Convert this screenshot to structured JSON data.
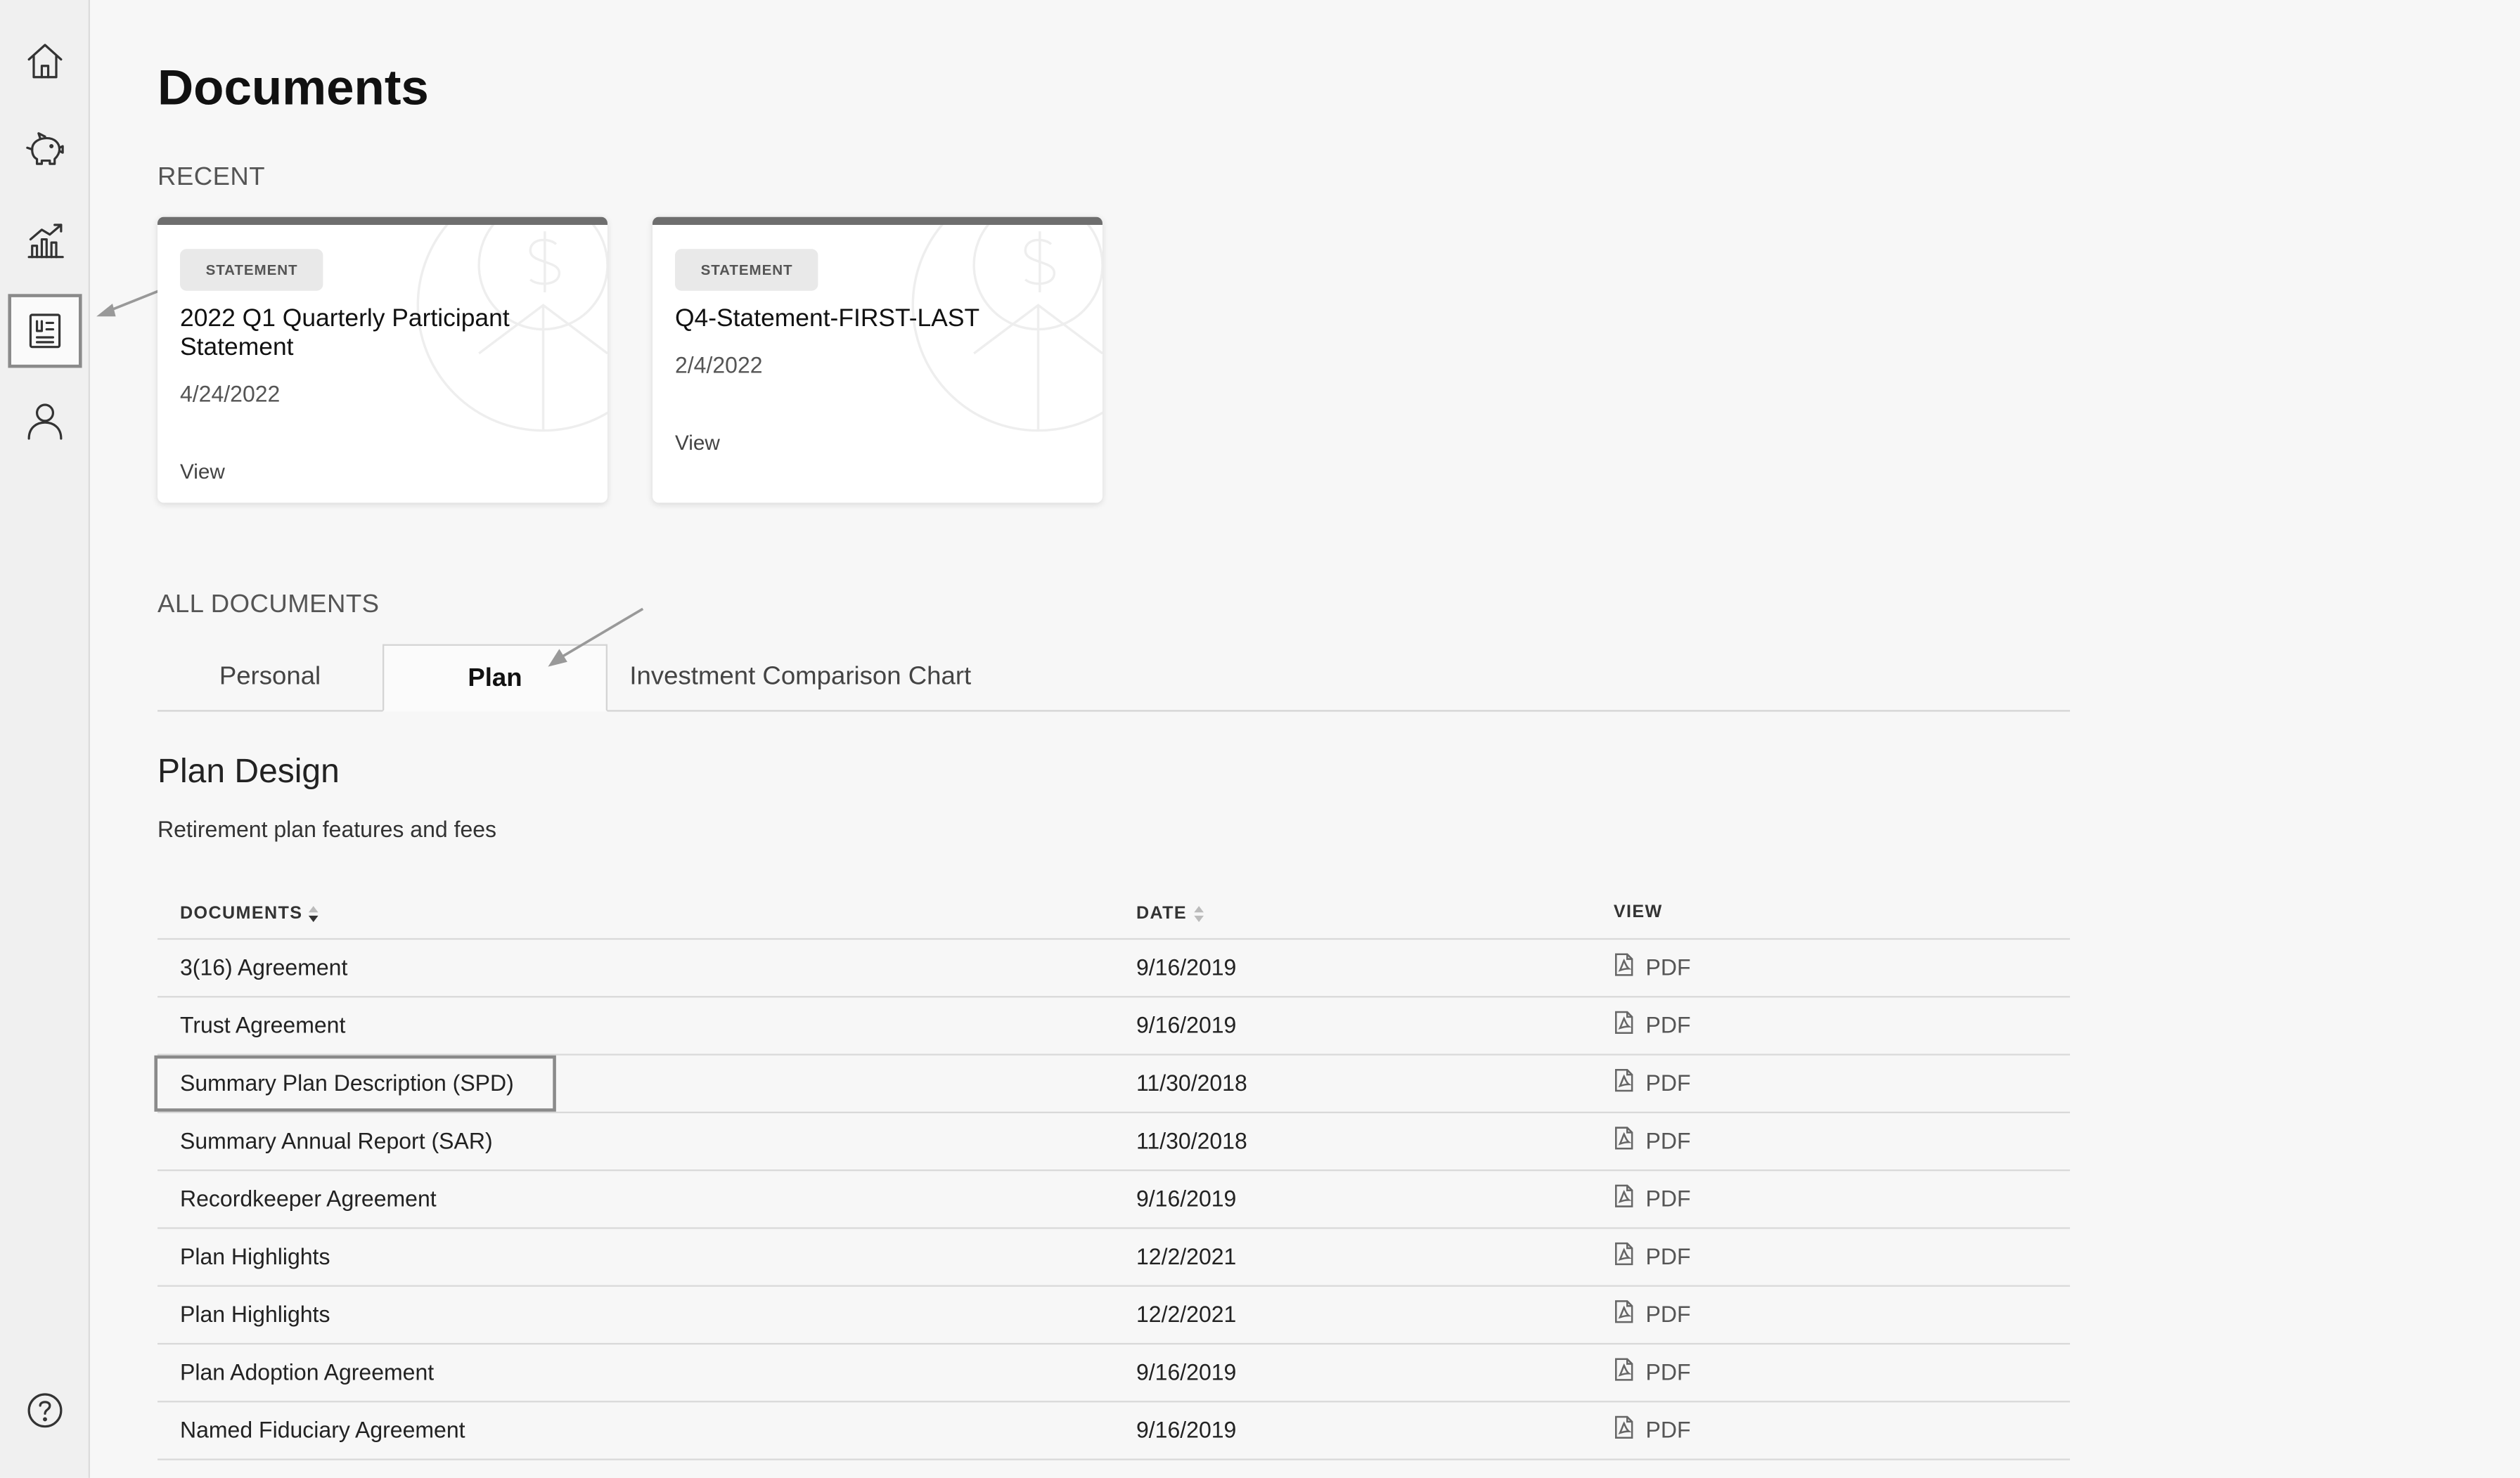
{
  "sidebar": {
    "items": [
      {
        "name": "home-icon"
      },
      {
        "name": "piggy-bank-icon"
      },
      {
        "name": "chart-icon"
      },
      {
        "name": "documents-icon",
        "active": true
      },
      {
        "name": "profile-icon"
      },
      {
        "name": "help-icon"
      }
    ]
  },
  "page": {
    "title": "Documents"
  },
  "recent": {
    "label": "RECENT",
    "cards": [
      {
        "badge": "STATEMENT",
        "title": "2022 Q1 Quarterly Participant Statement",
        "date": "4/24/2022",
        "action": "View"
      },
      {
        "badge": "STATEMENT",
        "title": "Q4-Statement-FIRST-LAST",
        "date": "2/4/2022",
        "action": "View"
      }
    ]
  },
  "all_documents": {
    "label": "ALL DOCUMENTS",
    "tabs": [
      {
        "label": "Personal",
        "active": false
      },
      {
        "label": "Plan",
        "active": true
      },
      {
        "label": "Investment Comparison Chart",
        "active": false
      }
    ]
  },
  "group": {
    "title": "Plan Design",
    "subtitle": "Retirement plan features and fees"
  },
  "table": {
    "headers": [
      "DOCUMENTS",
      "DATE",
      "VIEW"
    ],
    "rows": [
      {
        "name": "3(16) Agreement",
        "date": "9/16/2019",
        "view": "PDF"
      },
      {
        "name": "Trust Agreement",
        "date": "9/16/2019",
        "view": "PDF"
      },
      {
        "name": "Summary Plan Description (SPD)",
        "date": "11/30/2018",
        "view": "PDF"
      },
      {
        "name": "Summary Annual Report (SAR)",
        "date": "11/30/2018",
        "view": "PDF"
      },
      {
        "name": "Recordkeeper Agreement",
        "date": "9/16/2019",
        "view": "PDF"
      },
      {
        "name": "Plan Highlights",
        "date": "12/2/2021",
        "view": "PDF"
      },
      {
        "name": "Plan Highlights",
        "date": "12/2/2021",
        "view": "PDF"
      },
      {
        "name": "Plan Adoption Agreement",
        "date": "9/16/2019",
        "view": "PDF"
      },
      {
        "name": "Named Fiduciary Agreement",
        "date": "9/16/2019",
        "view": "PDF"
      }
    ]
  },
  "colors": {
    "background": "#f7f7f7",
    "sidebar": "#f0f0f0",
    "card_top_border": "#6e6e6e",
    "highlight_border": "#8a8a8a"
  }
}
